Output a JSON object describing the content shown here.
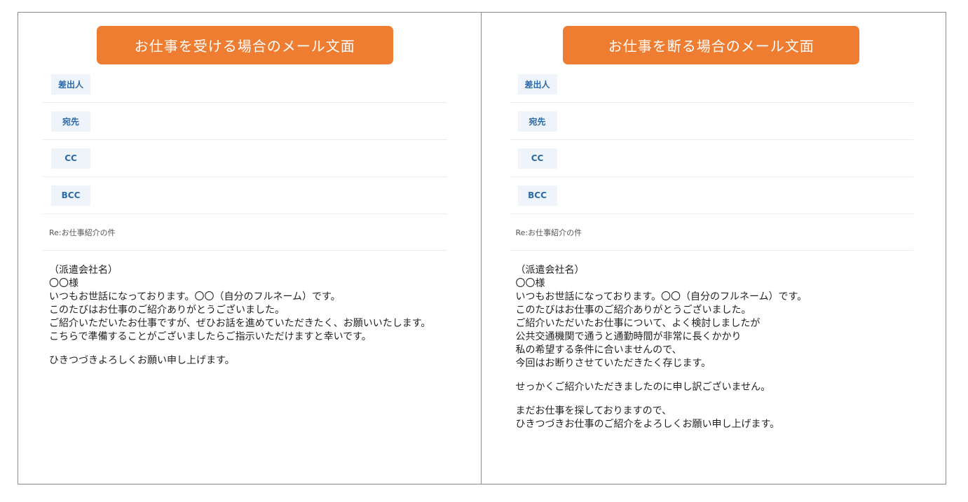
{
  "left": {
    "title": "お仕事を受ける場合のメール文面",
    "fields": [
      "差出人",
      "宛先",
      "CC",
      "BCC"
    ],
    "subject": "Re:お仕事紹介の件",
    "paragraphs": [
      [
        "（派遣会社名）",
        "〇〇様",
        "いつもお世話になっております。〇〇（自分のフルネーム）です。",
        "このたびはお仕事のご紹介ありがとうございました。",
        "ご紹介いただいたお仕事ですが、ぜひお話を進めていただきたく、お願いいたします。",
        "こちらで準備することがございましたらご指示いただけますと幸いです。"
      ],
      [
        "ひきつづきよろしくお願い申し上げます。"
      ]
    ]
  },
  "right": {
    "title": "お仕事を断る場合のメール文面",
    "fields": [
      "差出人",
      "宛先",
      "CC",
      "BCC"
    ],
    "subject": "Re:お仕事紹介の件",
    "paragraphs": [
      [
        "（派遣会社名）",
        "〇〇様",
        "いつもお世話になっております。〇〇（自分のフルネーム）です。",
        "このたびはお仕事のご紹介ありがとうございました。",
        "ご紹介いただいたお仕事について、よく検討しましたが",
        "公共交通機関で通うと通勤時間が非常に長くかかり",
        "私の希望する条件に合いませんので、",
        "今回はお断りさせていただきたく存じます。"
      ],
      [
        "せっかくご紹介いただきましたのに申し訳ございません。"
      ],
      [
        "まだお仕事を探しておりますので、",
        "ひきつづきお仕事のご紹介をよろしくお願い申し上げます。"
      ]
    ]
  }
}
